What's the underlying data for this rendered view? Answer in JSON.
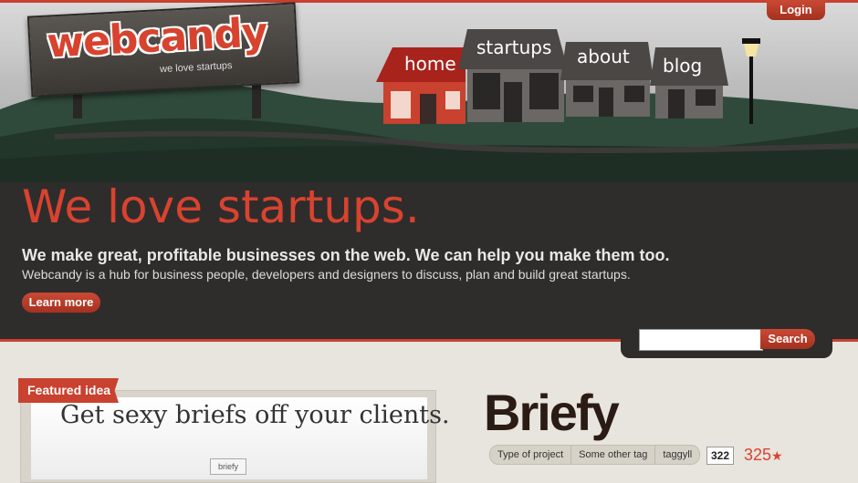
{
  "header": {
    "logo_text": "webcandy",
    "tagline": "we love startups",
    "login_label": "Login",
    "nav": [
      "home",
      "startups",
      "about",
      "blog"
    ]
  },
  "banner": {
    "headline": "We love startups.",
    "subheadline": "We make great, profitable businesses on the web.  We can help you make them too.",
    "description": "Webcandy is a hub for business people, developers and designers to discuss, plan and build great startups.",
    "learn_more": "Learn more"
  },
  "search": {
    "button_label": "Search",
    "value": ""
  },
  "featured": {
    "ribbon": "Featured idea",
    "image_headline": "Get sexy briefs off your clients.",
    "mini_logo": "briefy"
  },
  "idea": {
    "title": "Briefy",
    "tags": [
      "Type of project",
      "Some other tag",
      "taggyll"
    ],
    "comment_count": "322",
    "score": "325",
    "star": "★"
  },
  "colors": {
    "accent": "#c9412f",
    "dark_bg": "#2f2c2c",
    "page_bg": "#e8e4de"
  }
}
